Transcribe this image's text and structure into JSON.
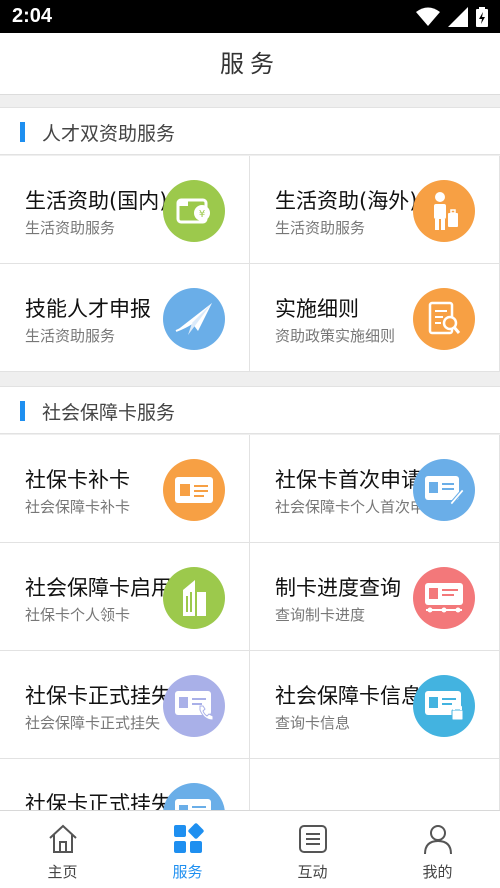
{
  "status_bar": {
    "time": "2:04"
  },
  "header": {
    "title": "服务"
  },
  "sections": [
    {
      "title": "人才双资助服务",
      "items": [
        {
          "title": "生活资助(国内)",
          "subtitle": "生活资助服务",
          "icon": "wallet-yuan-icon",
          "color": "#9cc94c"
        },
        {
          "title": "生活资助(海外)",
          "subtitle": "生活资助服务",
          "icon": "traveler-luggage-icon",
          "color": "#f7a044"
        },
        {
          "title": "技能人才申报",
          "subtitle": "生活资助服务",
          "icon": "paper-plane-icon",
          "color": "#6aaee8"
        },
        {
          "title": "实施细则",
          "subtitle": "资助政策实施细则",
          "icon": "document-search-icon",
          "color": "#f7a044"
        }
      ]
    },
    {
      "title": "社会保障卡服务",
      "items": [
        {
          "title": "社保卡补卡",
          "subtitle": "社会保障卡补卡",
          "icon": "id-card-icon",
          "color": "#f7a044"
        },
        {
          "title": "社保卡首次申请",
          "subtitle": "社会保障卡个人首次申请",
          "icon": "card-edit-icon",
          "color": "#6aaee8"
        },
        {
          "title": "社会保障卡启用",
          "subtitle": "社保卡个人领卡",
          "icon": "building-icon",
          "color": "#9cc94c"
        },
        {
          "title": "制卡进度查询",
          "subtitle": "查询制卡进度",
          "icon": "card-progress-icon",
          "color": "#f3787a"
        },
        {
          "title": "社保卡正式挂失",
          "subtitle": "社会保障卡正式挂失",
          "icon": "card-phone-icon",
          "color": "#a9b0e8"
        },
        {
          "title": "社会保障卡信息查询",
          "subtitle": "查询卡信息",
          "icon": "card-lock-icon",
          "color": "#43b3e0"
        },
        {
          "title": "社保卡正式挂失解挂",
          "subtitle": "",
          "icon": "card-unlock-icon",
          "color": "#6aaee8"
        }
      ]
    }
  ],
  "bottom_nav": [
    {
      "label": "主页",
      "icon": "home-icon",
      "active": false
    },
    {
      "label": "服务",
      "icon": "grid-icon",
      "active": true
    },
    {
      "label": "互动",
      "icon": "list-icon",
      "active": false
    },
    {
      "label": "我的",
      "icon": "user-icon",
      "active": false
    }
  ],
  "accent_color": "#1e8ff0"
}
